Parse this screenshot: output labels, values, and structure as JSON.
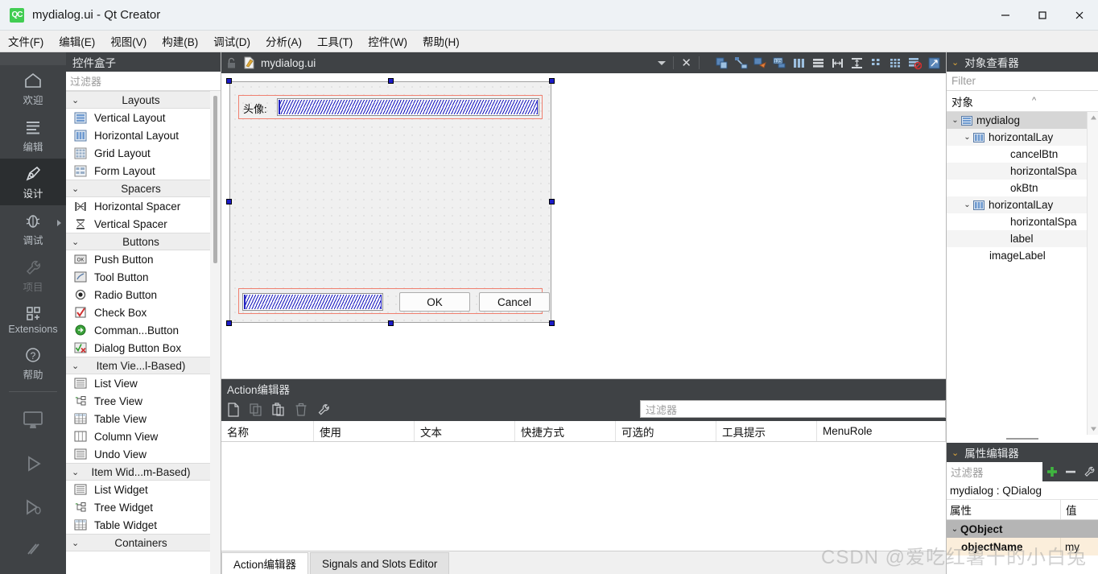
{
  "window": {
    "title": "mydialog.ui - Qt Creator",
    "logo_text": "QC",
    "minimize": "minimize-icon",
    "maximize": "maximize-icon",
    "close": "close-icon"
  },
  "menubar": {
    "items": [
      {
        "label": "文件(F)"
      },
      {
        "label": "编辑(E)"
      },
      {
        "label": "视图(V)"
      },
      {
        "label": "构建(B)"
      },
      {
        "label": "调试(D)"
      },
      {
        "label": "分析(A)"
      },
      {
        "label": "工具(T)"
      },
      {
        "label": "控件(W)"
      },
      {
        "label": "帮助(H)"
      }
    ]
  },
  "modebar": {
    "items": [
      {
        "label": "欢迎",
        "icon": "home-icon",
        "state": "normal"
      },
      {
        "label": "编辑",
        "icon": "lines-icon",
        "state": "normal"
      },
      {
        "label": "设计",
        "icon": "pen-icon",
        "state": "active"
      },
      {
        "label": "调试",
        "icon": "bug-icon",
        "state": "normal"
      },
      {
        "label": "项目",
        "icon": "wrench-icon",
        "state": "disabled"
      },
      {
        "label": "Extensions",
        "icon": "squares-plus-icon",
        "state": "normal"
      },
      {
        "label": "帮助",
        "icon": "question-circle-icon",
        "state": "normal"
      }
    ],
    "bottom_icons": [
      "monitor-icon",
      "run-icon",
      "debug-run-icon",
      "build-icon"
    ]
  },
  "widgetbox": {
    "title": "控件盒子",
    "filter_placeholder": "过滤器",
    "groups": [
      {
        "label": "Layouts",
        "items": [
          {
            "label": "Vertical Layout",
            "icon": "vertical-layout-icon"
          },
          {
            "label": "Horizontal Layout",
            "icon": "horizontal-layout-icon"
          },
          {
            "label": "Grid Layout",
            "icon": "grid-layout-icon"
          },
          {
            "label": "Form Layout",
            "icon": "form-layout-icon"
          }
        ]
      },
      {
        "label": "Spacers",
        "items": [
          {
            "label": "Horizontal Spacer",
            "icon": "horizontal-spacer-icon"
          },
          {
            "label": "Vertical Spacer",
            "icon": "vertical-spacer-icon"
          }
        ]
      },
      {
        "label": "Buttons",
        "items": [
          {
            "label": "Push Button",
            "icon": "push-button-icon"
          },
          {
            "label": "Tool Button",
            "icon": "tool-button-icon"
          },
          {
            "label": "Radio Button",
            "icon": "radio-button-icon"
          },
          {
            "label": "Check Box",
            "icon": "check-box-icon"
          },
          {
            "label": "Comman...Button",
            "icon": "command-link-button-icon"
          },
          {
            "label": "Dialog Button Box",
            "icon": "dialog-button-box-icon"
          }
        ]
      },
      {
        "label": "Item Vie...l-Based)",
        "items": [
          {
            "label": "List View",
            "icon": "list-view-icon"
          },
          {
            "label": "Tree View",
            "icon": "tree-view-icon"
          },
          {
            "label": "Table View",
            "icon": "table-view-icon"
          },
          {
            "label": "Column View",
            "icon": "column-view-icon"
          },
          {
            "label": "Undo View",
            "icon": "undo-view-icon"
          }
        ]
      },
      {
        "label": "Item Wid...m-Based)",
        "items": [
          {
            "label": "List Widget",
            "icon": "list-widget-icon"
          },
          {
            "label": "Tree Widget",
            "icon": "tree-widget-icon"
          },
          {
            "label": "Table Widget",
            "icon": "table-widget-icon"
          }
        ]
      },
      {
        "label": "Containers",
        "items": []
      }
    ]
  },
  "editor": {
    "filename": "mydialog.ui",
    "lock_icon": "lock-icon",
    "file_icon": "ui-file-icon",
    "close_label": "✕",
    "toolbar_icons": [
      "edit-widgets-icon",
      "edit-signals-slots-icon",
      "edit-buddies-icon",
      "edit-tab-order-icon",
      "layout-horizontally-icon",
      "layout-vertically-icon",
      "layout-splitter-h-icon",
      "layout-splitter-v-icon",
      "layout-form-icon",
      "layout-grid-icon",
      "break-layout-icon",
      "adjust-size-icon"
    ]
  },
  "form": {
    "label_text": "头像:",
    "ok_label": "OK",
    "cancel_label": "Cancel",
    "image_line_edit": "",
    "bottom_line_edit": ""
  },
  "action_editor": {
    "title": "Action编辑器",
    "filter_placeholder": "过滤器",
    "toolbar_icons": [
      "new-action-icon",
      "copy-icon",
      "paste-icon",
      "delete-icon",
      "configure-icon"
    ],
    "columns": [
      "名称",
      "使用",
      "文本",
      "快捷方式",
      "可选的",
      "工具提示",
      "MenuRole"
    ],
    "rows": [],
    "tabs": [
      {
        "label": "Action编辑器",
        "active": true
      },
      {
        "label": "Signals and Slots Editor",
        "active": false
      }
    ]
  },
  "object_inspector": {
    "title": "对象查看器",
    "filter_placeholder": "Filter",
    "column_label": "对象",
    "tree": [
      {
        "label": "mydialog",
        "indent": 0,
        "chev": "expanded",
        "icon": "vertical-layout-icon",
        "selected": true
      },
      {
        "label": "horizontalLay",
        "indent": 1,
        "chev": "expanded",
        "icon": "horizontal-layout-icon",
        "selected": false
      },
      {
        "label": "cancelBtn",
        "indent": 2,
        "chev": "none",
        "icon": "none",
        "selected": false
      },
      {
        "label": "horizontalSpa",
        "indent": 2,
        "chev": "none",
        "icon": "none",
        "selected": false
      },
      {
        "label": "okBtn",
        "indent": 2,
        "chev": "none",
        "icon": "none",
        "selected": false
      },
      {
        "label": "horizontalLay",
        "indent": 1,
        "chev": "expanded",
        "icon": "horizontal-layout-icon",
        "selected": false
      },
      {
        "label": "horizontalSpa",
        "indent": 2,
        "chev": "none",
        "icon": "none",
        "selected": false
      },
      {
        "label": "label",
        "indent": 2,
        "chev": "none",
        "icon": "none",
        "selected": false
      },
      {
        "label": "imageLabel",
        "indent": 1,
        "chev": "none",
        "icon": "none",
        "selected": false
      }
    ]
  },
  "property_editor": {
    "title": "属性编辑器",
    "filter_placeholder": "过滤器",
    "add_label": "+",
    "remove_label": "−",
    "configure_icon": "wrench-icon",
    "object_line": "mydialog : QDialog",
    "columns": [
      "属性",
      "值"
    ],
    "rows": [
      {
        "type": "group",
        "name": "QObject",
        "value": ""
      },
      {
        "type": "prop",
        "name": "objectName",
        "value": "my"
      }
    ]
  },
  "watermark": {
    "text": "CSDN @爱吃红薯干的小白兔"
  }
}
